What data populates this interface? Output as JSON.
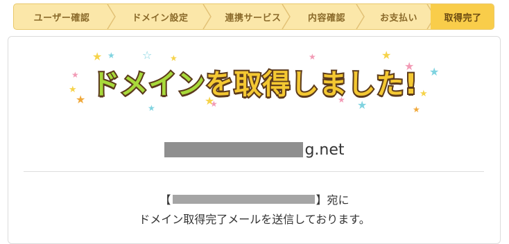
{
  "steps": [
    {
      "label": "ユーザー確認",
      "active": false
    },
    {
      "label": "ドメイン設定",
      "active": false
    },
    {
      "label": "連携サービス",
      "active": false
    },
    {
      "label": "内容確認",
      "active": false
    },
    {
      "label": "お支払い",
      "active": false
    },
    {
      "label": "取得完了",
      "active": true
    }
  ],
  "hero": {
    "part1": "ドメイン",
    "part2": "を取得しました!"
  },
  "domain": {
    "suffix": "g.net"
  },
  "message": {
    "open_bracket": "【",
    "close_bracket": "】宛に",
    "line2": "ドメイン取得完了メールを送信しております。"
  },
  "colors": {
    "step_bg": "#fbe7a9",
    "step_active_bg": "#f9cd4a",
    "hero_yellow": "#f4c832",
    "hero_green": "#a8d93a",
    "hero_outline": "#5b3a1c"
  }
}
